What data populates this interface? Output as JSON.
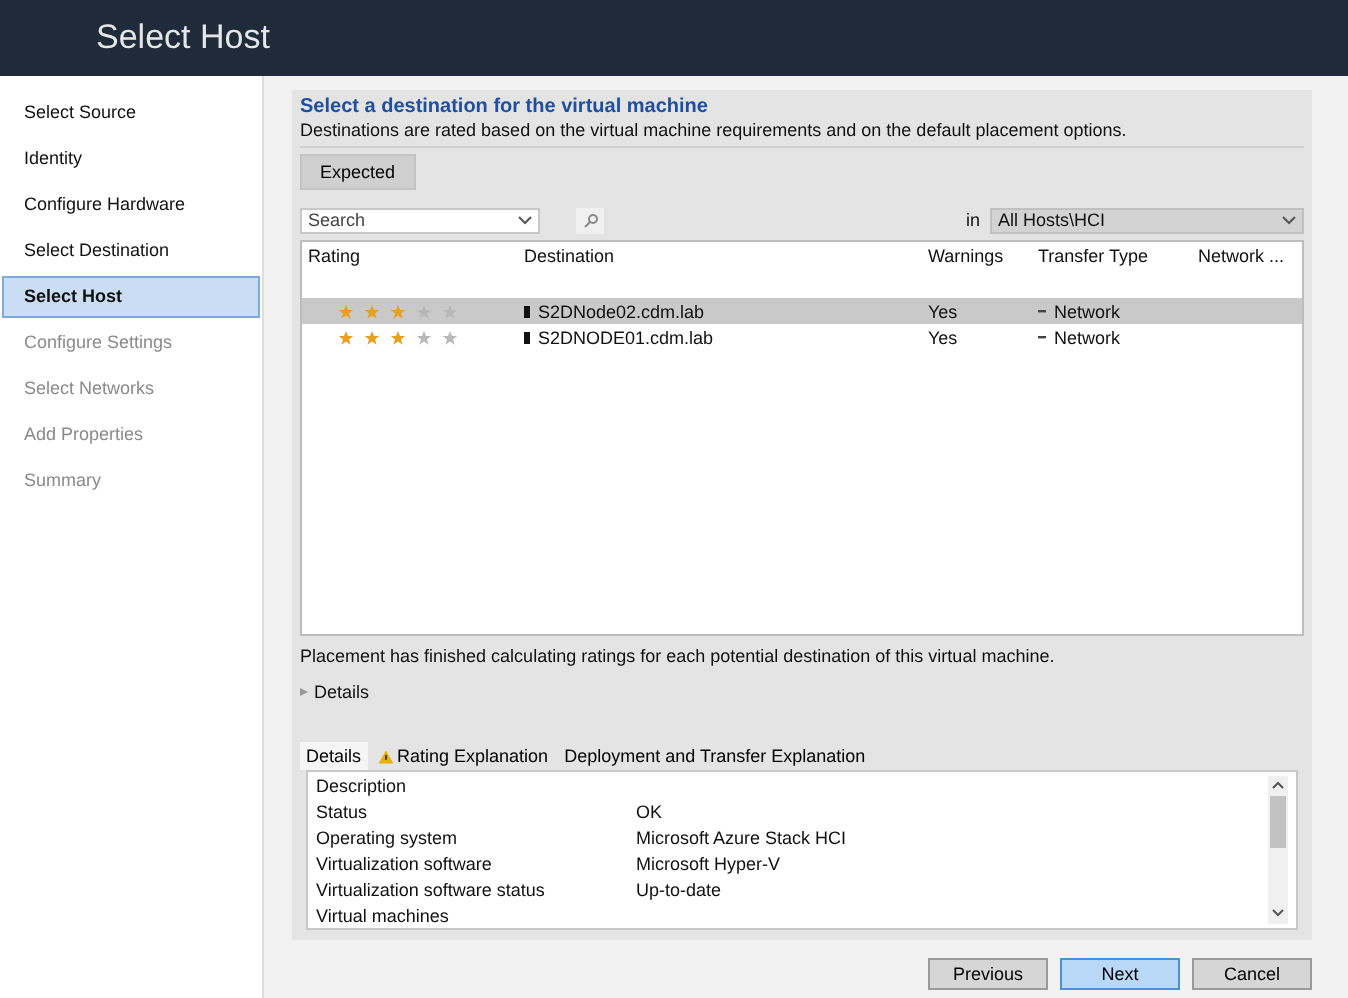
{
  "window": {
    "title": "Select Host"
  },
  "steps": [
    {
      "label": "Select Source",
      "selected": false,
      "disabled": false
    },
    {
      "label": "Identity",
      "selected": false,
      "disabled": false
    },
    {
      "label": "Configure Hardware",
      "selected": false,
      "disabled": false
    },
    {
      "label": "Select Destination",
      "selected": false,
      "disabled": false
    },
    {
      "label": "Select Host",
      "selected": true,
      "disabled": false
    },
    {
      "label": "Configure Settings",
      "selected": false,
      "disabled": true
    },
    {
      "label": "Select Networks",
      "selected": false,
      "disabled": true
    },
    {
      "label": "Add Properties",
      "selected": false,
      "disabled": true
    },
    {
      "label": "Summary",
      "selected": false,
      "disabled": true
    }
  ],
  "heading": "Select a destination for the virtual machine",
  "description": "Destinations are rated based on the virtual machine requirements and on the default placement options.",
  "expected_button": "Expected",
  "search": {
    "placeholder": "Search"
  },
  "scope": {
    "label": "in",
    "value": "All Hosts\\HCI"
  },
  "table": {
    "columns": [
      "Rating",
      "Destination",
      "Warnings",
      "Transfer Type",
      "Network ..."
    ],
    "rows": [
      {
        "stars": 3,
        "destination": "S2DNode02.cdm.lab",
        "warnings": "Yes",
        "transfer_type": "Network",
        "selected": true
      },
      {
        "stars": 3,
        "destination": "S2DNODE01.cdm.lab",
        "warnings": "Yes",
        "transfer_type": "Network",
        "selected": false
      }
    ]
  },
  "status_message": "Placement has finished calculating ratings for each potential destination of this virtual machine.",
  "details_expander": {
    "label": "Details",
    "expanded": false
  },
  "detail_tabs": [
    {
      "label": "Details",
      "selected": true,
      "warning": false
    },
    {
      "label": "Rating Explanation",
      "selected": false,
      "warning": true
    },
    {
      "label": "Deployment and Transfer Explanation",
      "selected": false,
      "warning": false
    }
  ],
  "details": [
    {
      "name": "Description"
    },
    {
      "name": "Status",
      "value": "OK"
    },
    {
      "name": "Operating system",
      "value": "Microsoft Azure Stack HCI"
    },
    {
      "name": "Virtualization software",
      "value": "Microsoft Hyper-V"
    },
    {
      "name": "Virtualization software status",
      "value": "Up-to-date"
    },
    {
      "name": "Virtual machines"
    }
  ],
  "buttons": [
    {
      "label": "Previous",
      "focused": false
    },
    {
      "label": "Next",
      "focused": true
    },
    {
      "label": "Cancel",
      "focused": false
    }
  ]
}
